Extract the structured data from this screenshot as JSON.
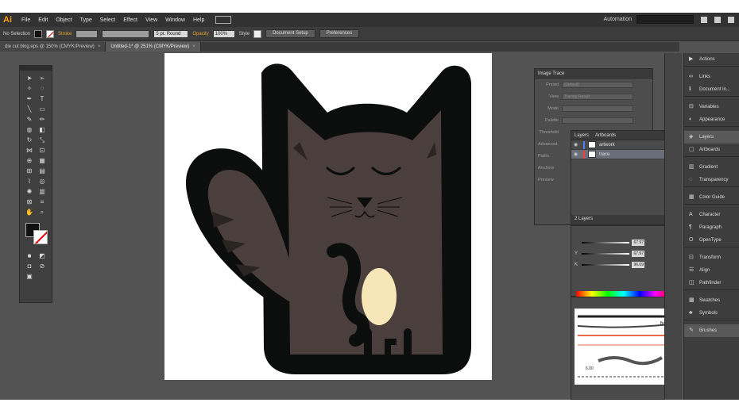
{
  "menubar": {
    "logo": "Ai",
    "items": [
      "File",
      "Edit",
      "Object",
      "Type",
      "Select",
      "Effect",
      "View",
      "Window",
      "Help"
    ],
    "workspace": "Automation"
  },
  "control_bar": {
    "selection": "No Selection",
    "stroke_label": "Stroke",
    "stroke_profile": "5 pt. Round",
    "opacity_label": "Opacity",
    "opacity_value": "100%",
    "style_label": "Style",
    "document_setup": "Document Setup",
    "preferences": "Preferences"
  },
  "tabs": [
    {
      "label": "die cut blog.eps @ 150% (CMYK/Preview)",
      "active": false
    },
    {
      "label": "Untitled-1* @ 251% (CMYK/Preview)",
      "active": true
    }
  ],
  "image_trace": {
    "title": "Image Trace",
    "rows": [
      {
        "label": "Preset",
        "value": "[Default]"
      },
      {
        "label": "View",
        "value": "Tracing Result"
      },
      {
        "label": "Mode",
        "value": ""
      },
      {
        "label": "Palette",
        "value": ""
      },
      {
        "label": "Threshold",
        "value": ""
      }
    ],
    "advanced": "Advanced",
    "status_paths": "Paths",
    "status_anchors": "Anchors",
    "preview": "Preview"
  },
  "layers": {
    "tabs": [
      "Layers",
      "Artboards"
    ],
    "rows": [
      {
        "name": "artwork",
        "selected": false,
        "color": "#4f7fff"
      },
      {
        "name": "trace",
        "selected": true,
        "color": "#ff3b3b"
      }
    ],
    "footer": "2 Layers"
  },
  "color": {
    "sliders": [
      {
        "label": "",
        "value": "67.97"
      },
      {
        "label": "Y",
        "value": "67.97"
      },
      {
        "label": "K",
        "value": "96.09"
      }
    ]
  },
  "brushes": {
    "label": "Basic",
    "size_value": "6.00"
  },
  "dock": {
    "groups": [
      [
        "Actions"
      ],
      [
        "Links",
        "Document In..."
      ],
      [
        "Variables",
        "Appearance"
      ],
      [
        "Layers",
        "Artboards"
      ],
      [
        "Gradient",
        "Transparency"
      ],
      [
        "Color Guide"
      ],
      [
        "Character",
        "Paragraph",
        "OpenType"
      ],
      [
        "Transform",
        "Align",
        "Pathfinder"
      ],
      [
        "Swatches",
        "Symbols"
      ],
      [
        "Brushes"
      ]
    ]
  },
  "artwork_colors": {
    "outline": "#0c0d0d",
    "body": "#4a3f3d",
    "belly": "#f7e6b7"
  }
}
